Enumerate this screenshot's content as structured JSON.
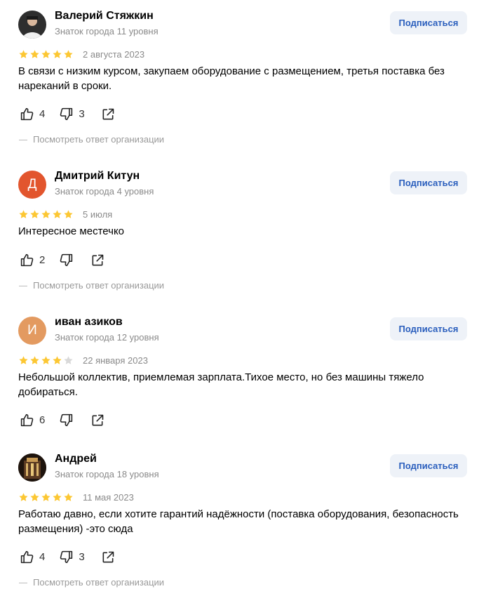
{
  "reviews": [
    {
      "name": "Валерий Стяжкин",
      "level": "Знаток города 11 уровня",
      "subscribe_label": "Подписаться",
      "rating": 5,
      "date": "2 августа 2023",
      "text": "В связи с низким курсом, закупаем оборудование с размещением, третья поставка без нареканий в сроки.",
      "likes": "4",
      "dislikes": "3",
      "reply_label": "Посмотреть ответ организации",
      "avatar_letter": "",
      "avatar_color": "#3a3a3a"
    },
    {
      "name": "Дмитрий Китун",
      "level": "Знаток города 4 уровня",
      "subscribe_label": "Подписаться",
      "rating": 5,
      "date": "5 июля",
      "text": "Интересное местечко",
      "likes": "2",
      "dislikes": "",
      "reply_label": "Посмотреть ответ организации",
      "avatar_letter": "Д",
      "avatar_color": "#e2552d"
    },
    {
      "name": "иван азиков",
      "level": "Знаток города 12 уровня",
      "subscribe_label": "Подписаться",
      "rating": 4,
      "date": "22 января 2023",
      "text": "Небольшой коллектив, приемлемая зарплата.Тихое место, но без машины тяжело добираться.",
      "likes": "6",
      "dislikes": "",
      "reply_label": "",
      "avatar_letter": "И",
      "avatar_color": "#e39a60"
    },
    {
      "name": "Андрей",
      "level": "Знаток города 18 уровня",
      "subscribe_label": "Подписаться",
      "rating": 5,
      "date": "11 мая 2023",
      "text": "Работаю давно, если хотите гарантий надёжности (поставка оборудования, безопасность размещения) -это сюда",
      "likes": "4",
      "dislikes": "3",
      "reply_label": "Посмотреть ответ организации",
      "avatar_letter": "",
      "avatar_color": "#2b1d14"
    }
  ],
  "colors": {
    "star_filled": "#fcc733",
    "star_empty": "#d9d9d9",
    "subscribe_bg": "#eef2f8",
    "subscribe_text": "#2a5ebd"
  },
  "icons": [
    "thumbs-up-icon",
    "thumbs-down-icon",
    "share-icon",
    "star-icon"
  ]
}
